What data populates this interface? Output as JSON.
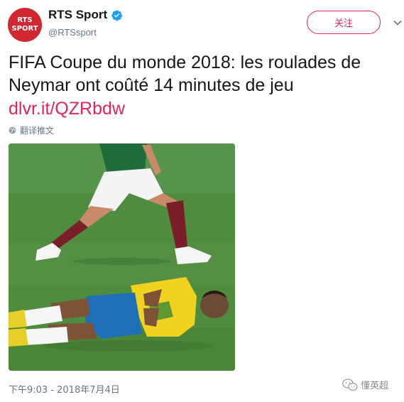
{
  "account": {
    "display_name": "RTS Sport",
    "handle": "@RTSsport",
    "avatar_line1": "RTS",
    "avatar_line2": "SPORT",
    "verified": true
  },
  "actions": {
    "follow_label": "关注"
  },
  "tweet": {
    "text": "FIFA Coupe du monde 2018: les roulades de Neymar ont coûté 14 minutes de jeu",
    "link": "dlvr.it/QZRbdw",
    "translate_label": "翻译推文",
    "timestamp": "下午9:03 - 2018年7月4日"
  },
  "watermark": {
    "label": "懂英超"
  },
  "colors": {
    "brand_red": "#d22630",
    "accent_pink": "#e0245e",
    "verified_blue": "#1da1f2",
    "text_primary": "#14171a",
    "text_secondary": "#657786"
  },
  "icons": {
    "verified": "verified-badge-icon",
    "chevron": "chevron-down-icon",
    "translate": "globe-icon",
    "watermark": "wechat-icon"
  }
}
